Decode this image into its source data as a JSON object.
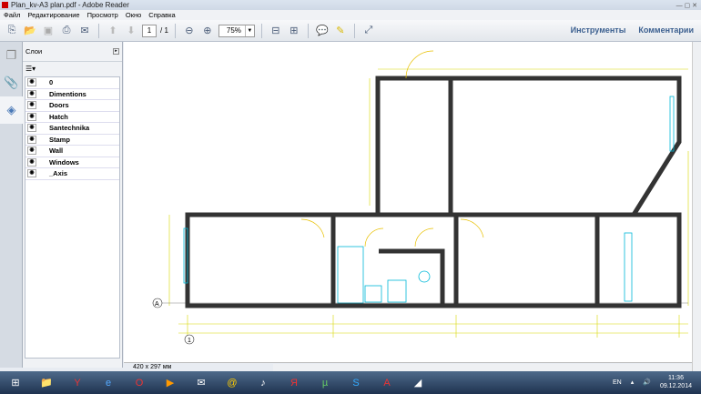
{
  "window": {
    "title": "Plan_kv-A3 plan.pdf - Adobe Reader"
  },
  "menu": [
    "Файл",
    "Редактирование",
    "Просмотр",
    "Окно",
    "Справка"
  ],
  "toolbar": {
    "page_current": "1",
    "page_total": "/ 1",
    "zoom": "75%",
    "tools_label": "Инструменты",
    "comments_label": "Комментарии"
  },
  "panel": {
    "title": "Слои",
    "layers": [
      "0",
      "Dimentions",
      "Doors",
      "Hatch",
      "Santechnika",
      "Stamp",
      "Wall",
      "Windows",
      "_Axis"
    ]
  },
  "drawing": {
    "axis_a": "А",
    "axis_1": "1"
  },
  "status": {
    "page_size": "420 x 297 мм"
  },
  "taskbar": {
    "lang": "EN",
    "time": "11:36",
    "date": "09.12.2014"
  },
  "colors": {
    "wall": "#333333",
    "dims": "#d8d800",
    "fixtures": "#00b8d8",
    "door": "#e8c000",
    "link": "#3b5f8f"
  }
}
